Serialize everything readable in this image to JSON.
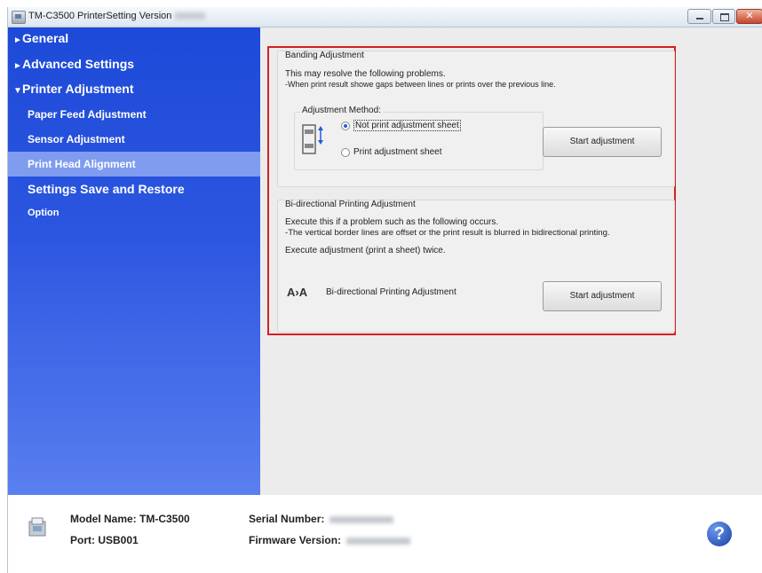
{
  "window": {
    "title": "TM-C3500 PrinterSetting Version",
    "controls": {
      "minimize_icon": "minimize-icon",
      "maximize_icon": "maximize-icon",
      "close_icon": "close-icon",
      "close_glyph": "✕"
    }
  },
  "sidebar": {
    "general": {
      "arrow": "►",
      "label": "General"
    },
    "advanced": {
      "arrow": "►",
      "label": "Advanced Settings"
    },
    "printer_adjustment": {
      "arrow": "▼",
      "label": "Printer Adjustment"
    },
    "paper_feed": "Paper Feed Adjustment",
    "sensor": "Sensor Adjustment",
    "print_head": "Print Head Alignment",
    "settings_save": "Settings Save and Restore",
    "option": "Option"
  },
  "banding": {
    "title": "Banding Adjustment",
    "line1": "This may resolve the following problems.",
    "line2": "-When print result showe gaps between lines or prints over the previous line.",
    "method_title": "Adjustment Method:",
    "option_not_print": "Not print adjustment sheet",
    "option_print": "Print adjustment sheet",
    "selected": "Not print adjustment sheet",
    "button": "Start adjustment"
  },
  "bidirectional": {
    "title": "Bi-directional Printing Adjustment",
    "line1": "Execute this if a problem such as the following occurs.",
    "line2": "-The vertical border lines are offset or the print result is blurred in bidirectional printing.",
    "line3": "Execute adjustment (print a sheet) twice.",
    "icon_label": "A›A",
    "label": "Bi-directional Printing Adjustment",
    "button": "Start adjustment"
  },
  "footer": {
    "model": "Model Name: TM-C3500",
    "port": "Port: USB001",
    "serial_label": "Serial Number:",
    "firmware_label": "Firmware Version:",
    "help_glyph": "?"
  },
  "colors": {
    "sidebar_top": "#1d4ad8",
    "sidebar_bottom": "#5a7ff0",
    "selected_item": "#7f9cef",
    "highlight_border": "#d51f1f"
  }
}
